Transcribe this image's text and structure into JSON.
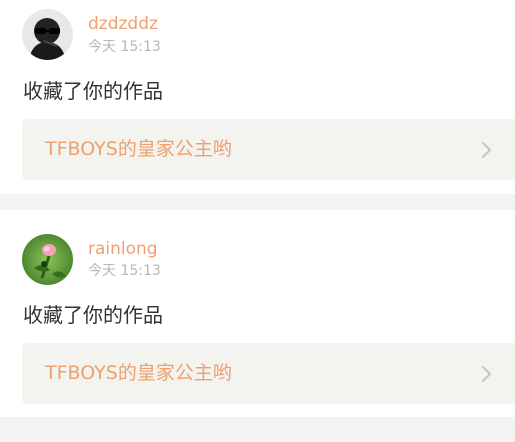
{
  "feed": {
    "items": [
      {
        "username": "dzdzddz",
        "timestamp": "今天 15:13",
        "action": "收藏了你的作品",
        "work_title": "TFBOYS的皇家公主哟"
      },
      {
        "username": "rainlong",
        "timestamp": "今天 15:13",
        "action": "收藏了你的作品",
        "work_title": "TFBOYS的皇家公主哟"
      }
    ]
  },
  "colors": {
    "accent": "#f0a06e",
    "background": "#f3f3f3",
    "card": "#ffffff",
    "link_box": "#f3f3ef",
    "timestamp": "#b7b7b7",
    "text": "#333333"
  },
  "icons": {
    "chevron": "chevron-right-icon"
  }
}
